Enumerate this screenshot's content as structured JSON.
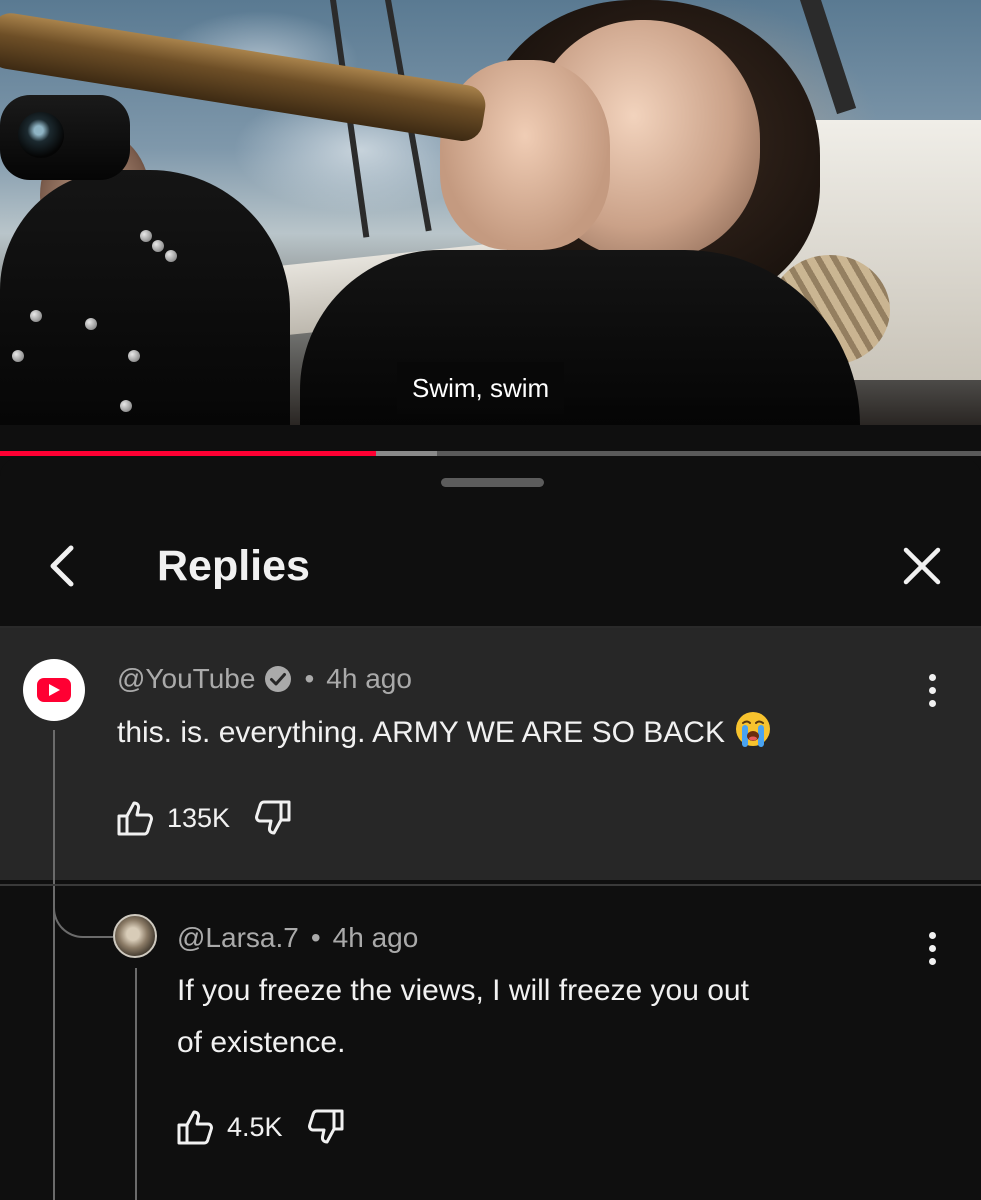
{
  "video": {
    "caption": "Swim, swim",
    "progress": 0.383,
    "buffered": 0.445
  },
  "panel": {
    "title": "Replies",
    "back_icon": "chevron-left-icon",
    "close_icon": "close-icon"
  },
  "comment": {
    "handle": "@YouTube",
    "verified": true,
    "separator": "•",
    "time": "4h ago",
    "text": "this. is. everything. ARMY WE ARE SO BACK",
    "emoji": "loudly-crying-face",
    "likes": "135K"
  },
  "reply": {
    "handle": "@Larsa.7",
    "separator": "•",
    "time": "4h ago",
    "text_line1": "If you freeze the views, I will freeze you out",
    "text_line2": "of existence.",
    "likes": "4.5K"
  },
  "colors": {
    "background": "#0f0f0f",
    "highlight": "#272727",
    "accent_red": "#ff0033",
    "text_primary": "#f1f1f1",
    "text_secondary": "#aaaaaa"
  }
}
